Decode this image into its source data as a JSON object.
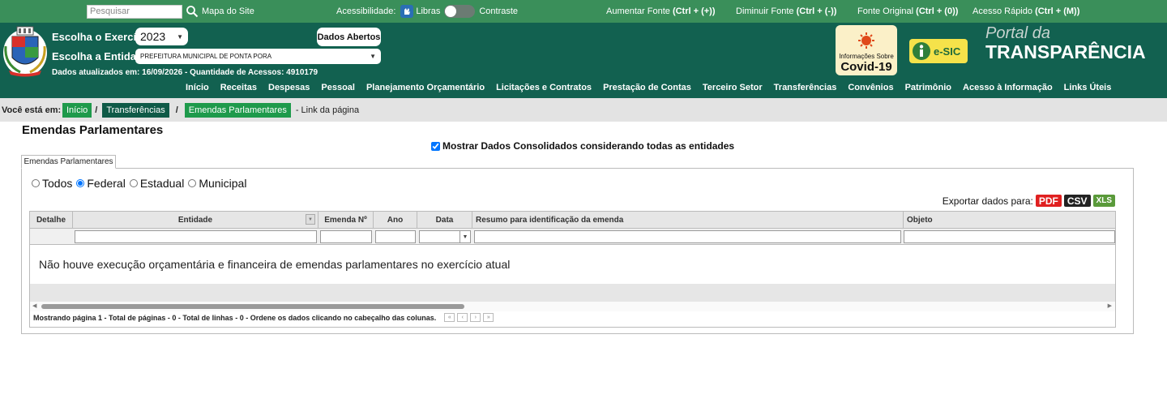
{
  "topbar": {
    "search_placeholder": "Pesquisar",
    "site_map": "Mapa do Site",
    "accessibility": "Acessibilidade:",
    "libras": "Libras",
    "contrast": "Contraste",
    "increase_font": "Aumentar Fonte",
    "increase_font_key": "(Ctrl + (+))",
    "decrease_font": "Diminuir Fonte",
    "decrease_font_key": "(Ctrl + (-))",
    "original_font": "Fonte Original",
    "original_font_key": "(Ctrl + (0))",
    "quick_access": "Acesso Rápido",
    "quick_access_key": "(Ctrl + (M))"
  },
  "header": {
    "exercise_label": "Escolha o Exercício:",
    "exercise_value": "2023",
    "entity_label": "Escolha a Entidade:",
    "entity_value": "PREFEITURA MUNICIPAL DE PONTA PORA",
    "open_data": "Dados Abertos",
    "updated": "Dados atualizados em: 16/09/2026 - Quantidade de Acessos: 4910179",
    "covid_small": "Informações Sobre",
    "covid_big": "Covid-19",
    "esic": "e-SIC",
    "portal_line1": "Portal da",
    "portal_line2": "TRANSPARÊNCIA"
  },
  "nav": [
    "Início",
    "Receitas",
    "Despesas",
    "Pessoal",
    "Planejamento Orçamentário",
    "Licitações e Contratos",
    "Prestação de Contas",
    "Terceiro Setor",
    "Transferências",
    "Convênios",
    "Patrimônio",
    "Acesso à Informação",
    "Links Úteis"
  ],
  "breadcrumb": {
    "label": "Você está em:",
    "items": [
      "Início",
      "Transferências",
      "Emendas Parlamentares"
    ],
    "sep": "/",
    "tail": "- Link da página"
  },
  "page_title": "Emendas Parlamentares",
  "consolidated_label": "Mostrar Dados Consolidados considerando todas as entidades",
  "tab_label": "Emendas Parlamentares",
  "filters": [
    "Todos",
    "Federal",
    "Estadual",
    "Municipal"
  ],
  "selected_filter": "Federal",
  "export": {
    "label": "Exportar dados para:",
    "pdf": "PDF",
    "csv": "CSV",
    "xls": "XLS"
  },
  "grid": {
    "columns": [
      "Detalhe",
      "Entidade",
      "Emenda Nº",
      "Ano",
      "Data",
      "Resumo para identificação da emenda",
      "Objeto"
    ],
    "empty_message": "Não houve execução orçamentária e financeira de emendas parlamentares no exercício atual",
    "footer": "Mostrando página 1 - Total de páginas - 0 - Total de linhas - 0 - Ordene os dados clicando no cabeçalho das colunas."
  },
  "colors": {
    "topbar": "#3a8f5a",
    "header": "#126150",
    "accent_green": "#1e9a4b",
    "crumb_dark": "#0f5a47",
    "pdf": "#e02020",
    "csv": "#222222",
    "xls": "#5a9a3a"
  }
}
